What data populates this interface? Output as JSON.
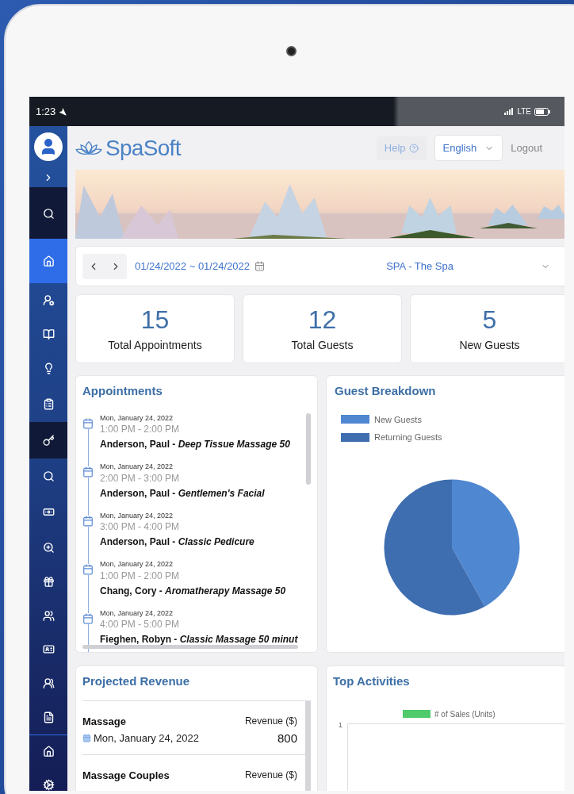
{
  "status_bar": {
    "time": "1:23",
    "network": "LTE"
  },
  "sidebar": {
    "items": [
      {
        "selected": false
      },
      {
        "selected": true
      },
      {
        "selected": false
      },
      {
        "selected": false
      },
      {
        "selected": false
      },
      {
        "selected": false
      },
      {
        "selected": false
      },
      {
        "selected": false
      },
      {
        "selected": false
      },
      {
        "selected": false
      },
      {
        "selected": false
      },
      {
        "selected": false
      },
      {
        "selected": false
      },
      {
        "selected": false
      },
      {
        "selected": false
      },
      {
        "selected": false
      },
      {
        "selected": false
      }
    ]
  },
  "header": {
    "logo": "SpaSoft",
    "help": {
      "label": "Help",
      "disabled": true
    },
    "language": "English",
    "logout": "Logout"
  },
  "date_bar": {
    "range": "01/24/2022 ~ 01/24/2022",
    "location": "SPA - The Spa"
  },
  "stats": [
    {
      "value": "15",
      "label": "Total Appointments"
    },
    {
      "value": "12",
      "label": "Total Guests"
    },
    {
      "value": "5",
      "label": "New Guests"
    }
  ],
  "appointments": {
    "title": "Appointments",
    "items": [
      {
        "date": "Mon, January 24, 2022",
        "time": "1:00 PM - 2:00 PM",
        "text": "Anderson, Paul - *Deep Tissue Massage 50*"
      },
      {
        "date": "Mon, January 24, 2022",
        "time": "2:00 PM - 3:00 PM",
        "text": "Anderson, Paul - *Gentlemen's Facial*"
      },
      {
        "date": "Mon, January 24, 2022",
        "time": "3:00 PM - 4:00 PM",
        "text": "Anderson, Paul - *Classic Pedicure*"
      },
      {
        "date": "Mon, January 24, 2022",
        "time": "1:00 PM - 2:00 PM",
        "text": "Chang, Cory - *Aromatherapy Massage 50*"
      },
      {
        "date": "Mon, January 24, 2022",
        "time": "4:00 PM - 5:00 PM",
        "text": "Fieghen, Robyn - *Classic Massage 50 minut*"
      }
    ]
  },
  "guest_breakdown": {
    "title": "Guest Breakdown",
    "legend": [
      {
        "label": "New Guests",
        "color": "#5087d1"
      },
      {
        "label": "Returning Guests",
        "color": "#3e6db0"
      }
    ]
  },
  "projected_revenue": {
    "title": "Projected Revenue",
    "rows": [
      {
        "name": "Massage",
        "date": "Mon, January 24, 2022",
        "revenue_label": "Revenue ($)",
        "amount": "800"
      },
      {
        "name": "Massage Couples",
        "revenue_label": "Revenue ($)"
      }
    ]
  },
  "top_activities": {
    "title": "Top Activities",
    "legend": {
      "label": "# of Sales (Units)",
      "color": "#4fcb6b"
    },
    "y_tick": "1"
  }
}
